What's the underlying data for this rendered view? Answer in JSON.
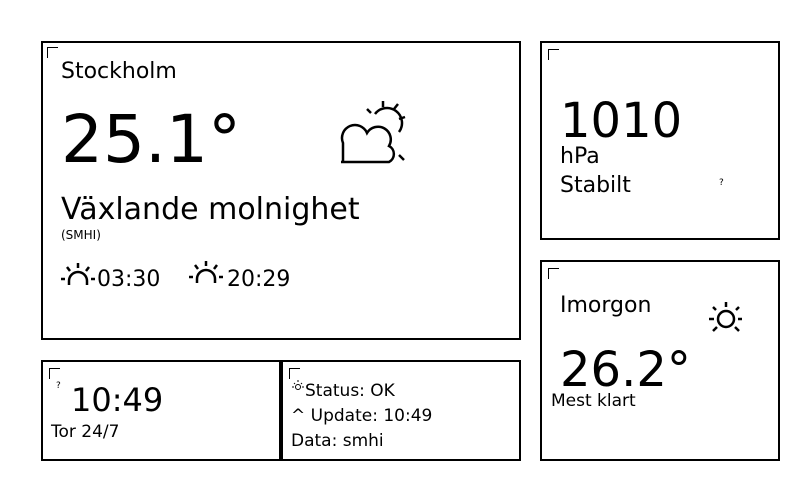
{
  "current": {
    "city": "Stockholm",
    "temperature": "25.1°",
    "condition": "Växlande molnighet",
    "source": "(SMHI)",
    "condition_icon": "partly-cloudy-icon",
    "sunrise_icon": "sunrise-icon",
    "sunrise": "03:30",
    "sunset_icon": "sunset-icon",
    "sunset": "20:29"
  },
  "pressure": {
    "value": "1010",
    "unit": "hPa",
    "trend": "Stabilt",
    "trend_marker": "?"
  },
  "clock": {
    "marker": "?",
    "time": "10:49",
    "date": "Tor 24/7"
  },
  "status": {
    "icon": "sun-icon",
    "status": "Status: OK",
    "update": "^ Update: 10:49",
    "data_source": "Data: smhi"
  },
  "tomorrow": {
    "label": "Imorgon",
    "icon": "sun-icon",
    "temperature": "26.2°",
    "condition": "Mest klart"
  }
}
